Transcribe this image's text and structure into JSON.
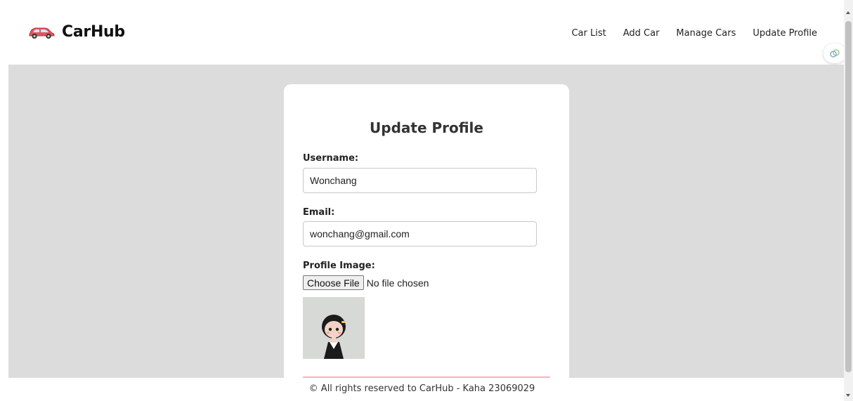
{
  "brand": {
    "name": "CarHub",
    "logo_icon": "car-icon"
  },
  "nav": {
    "items": [
      {
        "label": "Car List"
      },
      {
        "label": "Add Car"
      },
      {
        "label": "Manage Cars"
      },
      {
        "label": "Update Profile"
      }
    ]
  },
  "form": {
    "title": "Update Profile",
    "username_label": "Username:",
    "username_value": "Wonchang",
    "email_label": "Email:",
    "email_value": "wonchang@gmail.com",
    "image_label": "Profile Image:",
    "choose_file_label": "Choose File",
    "file_status": "No file chosen"
  },
  "footer": {
    "text": "© All rights reserved to CarHub - Kaha 23069029"
  },
  "colors": {
    "main_bg": "#dcdcdc",
    "card_bg": "#ffffff",
    "submit_accent": "#f4b5bb",
    "car_red": "#e2525f"
  }
}
